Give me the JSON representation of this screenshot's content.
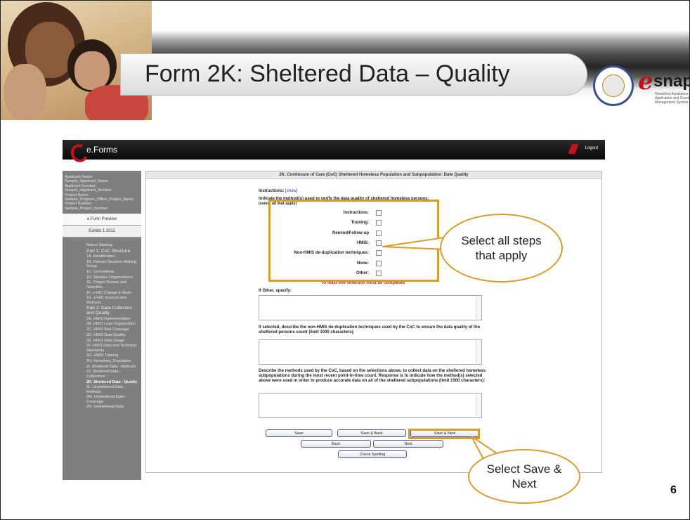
{
  "slide": {
    "title": "Form 2K: Sheltered Data – Quality",
    "number": "6",
    "logo_text": "snaps",
    "logo_tagline": "Homeless Assistance Application and Grants Management System",
    "callouts": {
      "select_all": "Select all steps that apply",
      "save_next": "Select Save & Next"
    }
  },
  "app": {
    "brand": "e.Forms",
    "logout": "Logout",
    "sidebar": {
      "info": [
        "Applicant Name:",
        "Sample_Applicant_Name",
        "Applicant Number:",
        "Sample_Applicant_Number",
        "Project Name:",
        "Sample_Program_Office_Project_Name",
        "Project Number:",
        "Sample_Project_Number"
      ],
      "tabs": [
        "e.Form Preview",
        "Exhibit 1 2011"
      ],
      "nav": [
        {
          "label": "Before Starting",
          "type": "item"
        },
        {
          "label": "Part 1: CoC Structure",
          "type": "hd"
        },
        {
          "label": "1A. Identification",
          "type": "item"
        },
        {
          "label": "1B. Primary Decision-Making Group",
          "type": "item"
        },
        {
          "label": "1C. Committees",
          "type": "item"
        },
        {
          "label": "1D. Member Organizations",
          "type": "item"
        },
        {
          "label": "1E. Project Review and Selection",
          "type": "item"
        },
        {
          "label": "1F. e-HIC Change in Beds",
          "type": "item"
        },
        {
          "label": "1G. e-HIC Sources and Methods",
          "type": "item"
        },
        {
          "label": "Part 2: Data Collection and Quality",
          "type": "hd"
        },
        {
          "label": "2A. HMIS Implementation",
          "type": "item"
        },
        {
          "label": "2B. HMIS Lead Organization",
          "type": "item"
        },
        {
          "label": "2C. HMIS Bed Coverage",
          "type": "item"
        },
        {
          "label": "2D. HMIS Data Quality",
          "type": "item"
        },
        {
          "label": "2E. HMIS Data Usage",
          "type": "item"
        },
        {
          "label": "2F. HMIS Data and Technical Standards",
          "type": "item"
        },
        {
          "label": "2G. HMIS Training",
          "type": "item"
        },
        {
          "label": "2H. Homeless_Population",
          "type": "item"
        },
        {
          "label": "2I. Sheltered Data - Methods",
          "type": "item"
        },
        {
          "label": "2J. Sheltered Data - Collections",
          "type": "item"
        },
        {
          "label": "2K. Sheltered Data - Quality",
          "type": "cur"
        },
        {
          "label": "2L. Unsheltered Data - Methods",
          "type": "item"
        },
        {
          "label": "2M. Unsheltered Data - Coverage",
          "type": "item"
        },
        {
          "label": "2N. Unsheltered Data",
          "type": "item"
        }
      ]
    },
    "form": {
      "header": "2K. Continuum of Care (CoC) Sheltered Homeless Population and Subpopulation: Date Quality",
      "instructions_label": "Instructions:",
      "instructions_link": "[show]",
      "question1": "Indicate the method(s) used to verify the data quality of sheltered homeless persons:",
      "question1_hint": "(select all that apply)",
      "checkboxes": [
        "Instructions:",
        "Training:",
        "Remind/Follow-up",
        "HMIS:",
        "Non-HMIS de-duplication techniques:",
        "None:",
        "Other:"
      ],
      "error": "At least one selection must be completed",
      "other_label": "If Other, specify:",
      "dedup_label": "If selected, describe the non-HMIS de-duplication techniques used by the CoC to ensure the data quality of the sheltered persons count (limit 1000 characters).",
      "methods_label": "Describe the methods used by the CoC, based on the selections above, to collect data on the sheltered homeless subpopulations during the most recent point-in-time count. Response is to indicate how the method(s) selected above were used in order to produce accurate data on all of the sheltered subpopulations (limit 1500 characters):",
      "buttons": {
        "save": "Save",
        "save_back": "Save & Back",
        "save_next": "Save & Next",
        "back": "Back",
        "next": "Next",
        "check_spelling": "Check Spelling"
      }
    }
  },
  "colors": {
    "accent": "#d79b2e",
    "error": "#c8201a",
    "brand_red": "#c2121b"
  }
}
